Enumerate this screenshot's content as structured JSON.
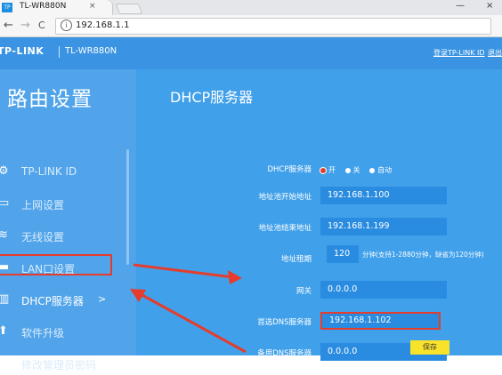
{
  "browser": {
    "tab_icon": "TP",
    "tab_title": "TL-WR880N",
    "tab_close": "×",
    "url": "192.168.1.1",
    "back": "←",
    "forward": "→",
    "reload": "C",
    "info": "i",
    "win_min": "—",
    "win_close": "×"
  },
  "header": {
    "logo": "TP-LINK",
    "model": "TL-WR880N",
    "login_link": "登录TP-LINK ID",
    "exit_link": "退出"
  },
  "sidebar": {
    "title": "路由设置",
    "items": [
      {
        "label": "TP-LINK ID",
        "icon": "gear-icon",
        "glyph": "⚙"
      },
      {
        "label": "上网设置",
        "icon": "monitor-icon",
        "glyph": "▭"
      },
      {
        "label": "无线设置",
        "icon": "wifi-icon",
        "glyph": "≋"
      },
      {
        "label": "LAN口设置",
        "icon": "lan-port-icon",
        "glyph": "▬"
      },
      {
        "label": "DHCP服务器",
        "icon": "dhcp-icon",
        "glyph": "▥",
        "arrow": ">"
      },
      {
        "label": "软件升级",
        "icon": "upload-icon",
        "glyph": "⬆"
      },
      {
        "label": "修改管理员密码",
        "icon": "pencil-icon",
        "glyph": "✎"
      }
    ]
  },
  "main": {
    "title": "DHCP服务器",
    "dhcp_server": {
      "label": "DHCP服务器",
      "options": [
        "开",
        "关",
        "自动"
      ],
      "selected": "开"
    },
    "start_ip": {
      "label": "地址池开始地址",
      "value": "192.168.1.100"
    },
    "end_ip": {
      "label": "地址池结束地址",
      "value": "192.168.1.199"
    },
    "lease": {
      "label": "地址租期",
      "value": "120",
      "hint": "分钟(支持1-2880分钟，缺省为120分钟)"
    },
    "gateway": {
      "label": "网关",
      "value": "0.0.0.0"
    },
    "primary_dns": {
      "label": "首选DNS服务器",
      "value": "192.168.1.102"
    },
    "secondary_dns": {
      "label": "备用DNS服务器",
      "value": "0.0.0.0"
    },
    "save_label": "保存"
  },
  "colors": {
    "header": "#3a94e3",
    "sidebar": "#51a4ea",
    "main": "#40a0ea",
    "field": "#2a8ce0",
    "highlight": "#e53c2d",
    "save": "#f9e22a"
  }
}
